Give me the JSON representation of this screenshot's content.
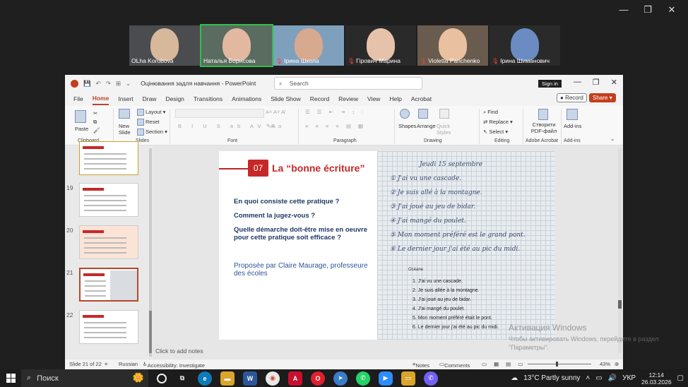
{
  "window": {
    "minimize": "—",
    "maximize": "❐",
    "close": "✕"
  },
  "participants": [
    {
      "name": "OLha Korobova",
      "muted": false,
      "bg": "#4a4c4f",
      "skin": "#d8b89a",
      "active": false
    },
    {
      "name": "Наталья Борисова",
      "muted": false,
      "bg": "#5a6b5f",
      "skin": "#e2b8a0",
      "active": true
    },
    {
      "name": "Ірина Школа",
      "muted": true,
      "bg": "#7fa0bd",
      "skin": "#d7a98f",
      "active": false
    },
    {
      "name": "Гірович Марина",
      "muted": true,
      "bg": "#2a2a2a",
      "skin": "#e6c2aa",
      "active": false
    },
    {
      "name": "Violetta Panchenko",
      "muted": true,
      "bg": "#6a5b4f",
      "skin": "#e9c0a0",
      "active": false
    },
    {
      "name": "Ірина Шиманович",
      "muted": true,
      "bg": "#2a2a2a",
      "skin": "#6a8cc2",
      "active": false
    }
  ],
  "ppt": {
    "doc_title": "Оцінювання задля навчання  -  PowerPoint",
    "search_placeholder": "Search",
    "sign_in": "Sign in",
    "tabs": [
      "File",
      "Home",
      "Insert",
      "Draw",
      "Design",
      "Transitions",
      "Animations",
      "Slide Show",
      "Record",
      "Review",
      "View",
      "Help",
      "Acrobat"
    ],
    "record_label": "Record",
    "share_label": "Share",
    "ribbon": {
      "paste": "Paste",
      "clipboard": "Clipboard",
      "new_slide": "New Slide",
      "layout": "Layout",
      "reset": "Reset",
      "section": "Section",
      "slides": "Slides",
      "font": "Font",
      "paragraph": "Paragraph",
      "shapes": "Shapes",
      "arrange": "Arrange",
      "quick_styles": "Quick Styles",
      "drawing": "Drawing",
      "find": "Find",
      "replace": "Replace",
      "select": "Select",
      "editing": "Editing",
      "create_pdf": "Створити PDF-файл",
      "adobe_acrobat": "Adobe Acrobat",
      "addins": "Add-ins",
      "addins_group": "Add-ins"
    },
    "thumbnails": [
      {
        "num": "",
        "selected": false
      },
      {
        "num": "19",
        "selected": false
      },
      {
        "num": "20",
        "selected": false
      },
      {
        "num": "21",
        "selected": true
      },
      {
        "num": "22",
        "selected": false
      }
    ],
    "slide": {
      "number": "07",
      "title": "La “bonne écriture”",
      "questions": [
        "En quoi consiste cette pratique ?",
        "Comment la jugez-vous ?",
        "Quelle démarche doit-être mise en oeuvre pour cette pratique soit efficace ?"
      ],
      "author": "Proposée par Claire Maurage, professeure des écoles",
      "handwritten": [
        "Jeudi 15 septembre",
        "① J'ai vu une cascade.",
        "② Je suis allé à la montagne.",
        "③ J'ai joué au jeu de bidar.",
        "④ J'ai mangé du poulet.",
        "⑤ Mon moment préféré est le grand pont.",
        "⑥ Le dernier jour j'ai été au pic du midi."
      ],
      "printed_header": "Océane",
      "printed": [
        "1. J'ai vu une cascade.",
        "2. Je suis allée à la montagne.",
        "3. J'ai joué au jeu de bidar.",
        "4. J'ai mangé du poulet.",
        "5. Mon moment préféré était le pont.",
        "6. Le dernier jour j'ai été au pic du midi."
      ]
    },
    "notes_placeholder": "Click to add notes",
    "status": {
      "slide_of": "Slide 21 of 22",
      "language": "Russian",
      "accessibility": "Accessibility: Investigate",
      "notes": "Notes",
      "comments": "Comments",
      "zoom": "43%"
    }
  },
  "watermark": {
    "line1": "Активация Windows",
    "line2": "Чтобы активировать Windows, перейдите в раздел",
    "line3": "\"Параметры\"."
  },
  "taskbar": {
    "search_text": "Поиск",
    "weather": "13°C  Partly sunny",
    "lang": "УКР",
    "time": "12:14",
    "date": "26.03.2026"
  }
}
